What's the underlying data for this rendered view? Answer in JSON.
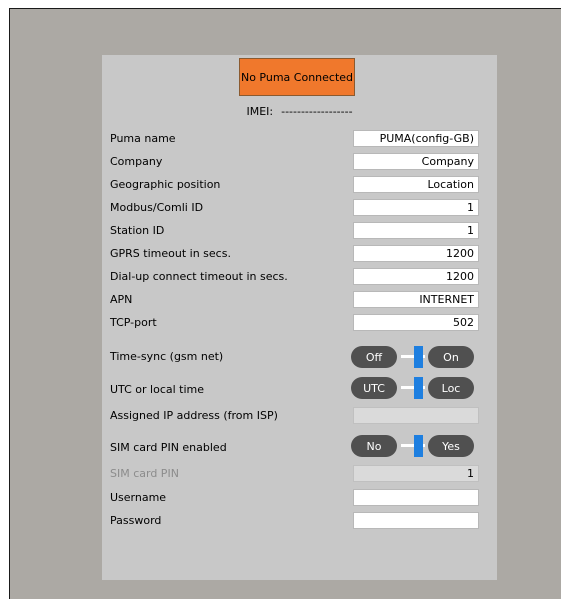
{
  "status": {
    "text": "No Puma Connected"
  },
  "imei": {
    "label": "IMEI:",
    "value": "------------------"
  },
  "fields": [
    {
      "label": "Puma name",
      "value": "PUMA(config-GB)"
    },
    {
      "label": "Company",
      "value": "Company"
    },
    {
      "label": "Geographic position",
      "value": "Location"
    },
    {
      "label": "Modbus/Comli ID",
      "value": "1"
    },
    {
      "label": "Station ID",
      "value": "1"
    },
    {
      "label": "GPRS timeout in secs.",
      "value": "1200"
    },
    {
      "label": "Dial-up connect timeout in secs.",
      "value": "1200"
    },
    {
      "label": "APN",
      "value": "INTERNET"
    },
    {
      "label": "TCP-port",
      "value": "502"
    }
  ],
  "time_sync": {
    "label": "Time-sync (gsm net)",
    "off": "Off",
    "on": "On",
    "state": "on"
  },
  "utc_local": {
    "label": "UTC or local time",
    "utc": "UTC",
    "loc": "Loc",
    "state": "loc"
  },
  "assigned_ip": {
    "label": "Assigned IP address (from ISP)",
    "value": ""
  },
  "sim_pin_enabled": {
    "label": "SIM card PIN enabled",
    "no": "No",
    "yes": "Yes",
    "state": "no"
  },
  "sim_pin": {
    "label": "SIM card PIN",
    "value": "1"
  },
  "username": {
    "label": "Username",
    "value": ""
  },
  "password": {
    "label": "Password",
    "value": ""
  },
  "colors": {
    "status_bg": "#f0782c",
    "toggle_pill": "#505050",
    "toggle_knob": "#1e7fe0",
    "panel_bg": "#c8c8c8",
    "frame_bg": "#aca9a4"
  }
}
